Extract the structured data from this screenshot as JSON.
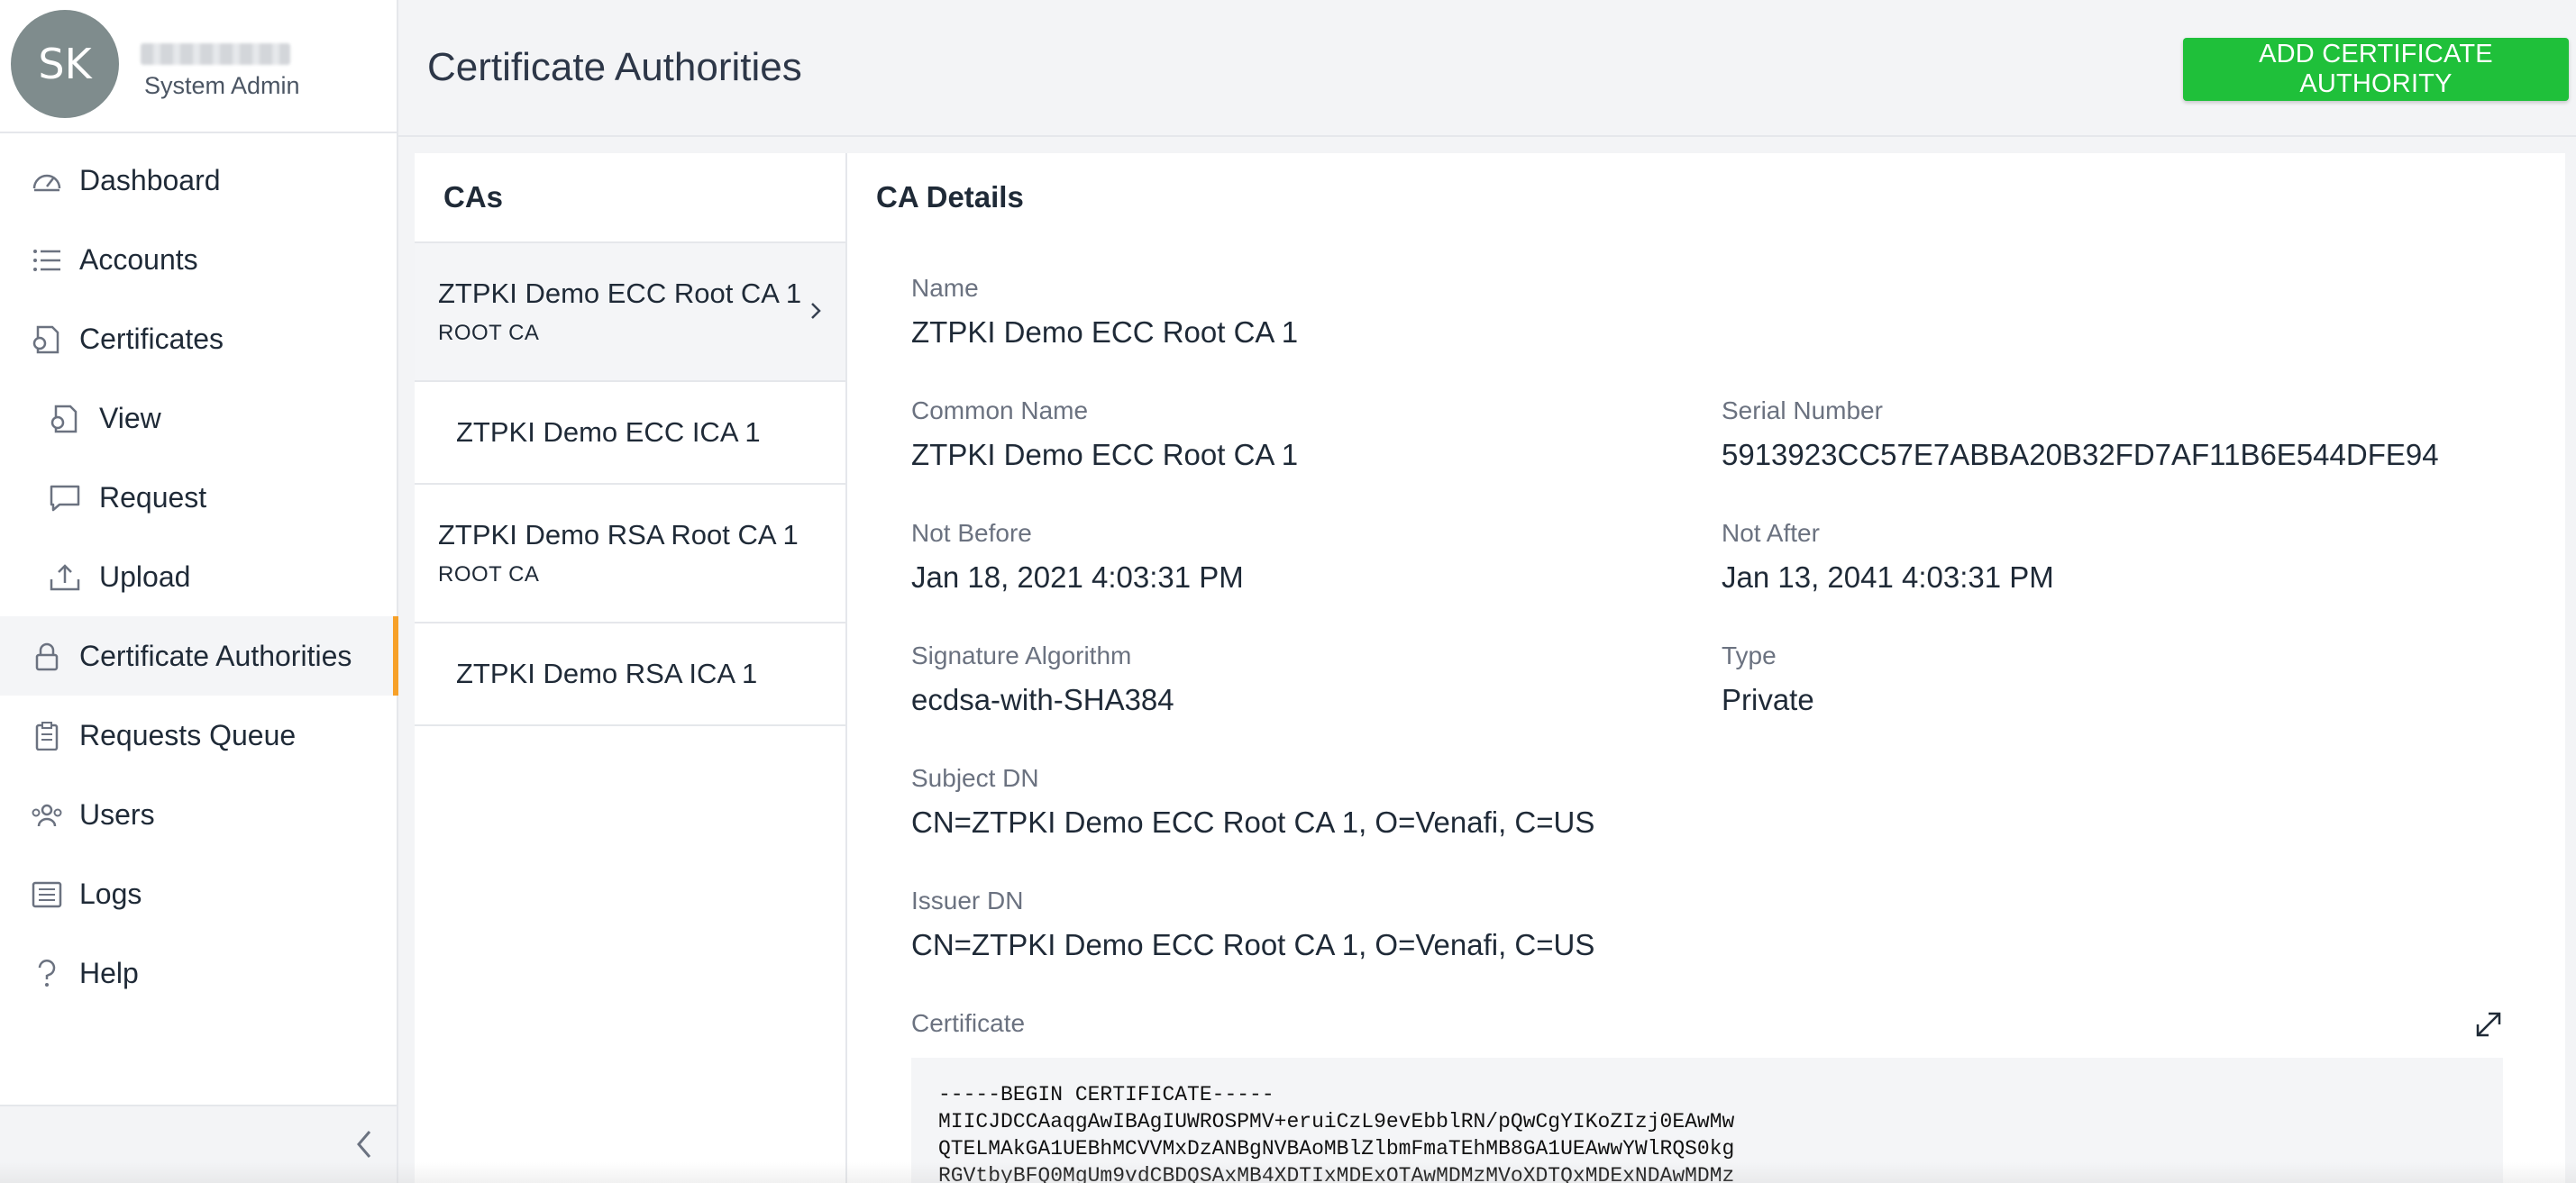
{
  "user": {
    "initials": "SK",
    "role": "System Admin"
  },
  "nav": [
    {
      "label": "Dashboard",
      "icon": "dashboard-icon"
    },
    {
      "label": "Accounts",
      "icon": "list-icon"
    },
    {
      "label": "Certificates",
      "icon": "certificate-icon"
    },
    {
      "label": "View",
      "icon": "view-certificate-icon"
    },
    {
      "label": "Request",
      "icon": "chat-bubble-icon"
    },
    {
      "label": "Upload",
      "icon": "upload-icon"
    },
    {
      "label": "Certificate Authorities",
      "icon": "lock-icon",
      "active": true
    },
    {
      "label": "Requests Queue",
      "icon": "clipboard-icon"
    },
    {
      "label": "Users",
      "icon": "users-icon"
    },
    {
      "label": "Logs",
      "icon": "logs-icon"
    },
    {
      "label": "Help",
      "icon": "help-icon"
    }
  ],
  "header": {
    "title": "Certificate Authorities",
    "add_button": "ADD CERTIFICATE AUTHORITY"
  },
  "ca_list": {
    "heading": "CAs",
    "items": [
      {
        "name": "ZTPKI Demo ECC Root CA 1",
        "tag": "ROOT CA",
        "selected": true
      },
      {
        "name": "ZTPKI Demo ECC ICA 1"
      },
      {
        "name": "ZTPKI Demo RSA Root CA 1",
        "tag": "ROOT CA"
      },
      {
        "name": "ZTPKI Demo RSA ICA 1"
      }
    ]
  },
  "details": {
    "heading": "CA Details",
    "name_label": "Name",
    "name": "ZTPKI Demo ECC Root CA 1",
    "common_name_label": "Common Name",
    "common_name": "ZTPKI Demo ECC Root CA 1",
    "serial_label": "Serial Number",
    "serial": "5913923CC57E7ABBA20B32FD7AF11B6E544DFE94",
    "not_before_label": "Not Before",
    "not_before": "Jan 18, 2021 4:03:31 PM",
    "not_after_label": "Not After",
    "not_after": "Jan 13, 2041 4:03:31 PM",
    "sig_alg_label": "Signature Algorithm",
    "sig_alg": "ecdsa-with-SHA384",
    "type_label": "Type",
    "type": "Private",
    "subject_dn_label": "Subject DN",
    "subject_dn": "CN=ZTPKI Demo ECC Root CA 1, O=Venafi, C=US",
    "issuer_dn_label": "Issuer DN",
    "issuer_dn": "CN=ZTPKI Demo ECC Root CA 1, O=Venafi, C=US",
    "certificate_label": "Certificate",
    "certificate_lines": [
      "-----BEGIN CERTIFICATE-----",
      "MIICJDCCAaqgAwIBAgIUWROSPMV+eruiCzL9evEbblRN/pQwCgYIKoZIzj0EAwMw",
      "QTELMAkGA1UEBhMCVVMxDzANBgNVBAoMBlZlbmFmaTEhMB8GA1UEAwwYWlRQS0kg",
      "RGVtbyBFQ0MgUm9vdCBDQSAxMB4XDTIxMDExOTAwMDMzMVoXDTQxMDExNDAwMDMz"
    ]
  },
  "colors": {
    "accent": "#f7a129",
    "primary_button": "#1fc03a",
    "avatar": "#7f8c8d"
  }
}
